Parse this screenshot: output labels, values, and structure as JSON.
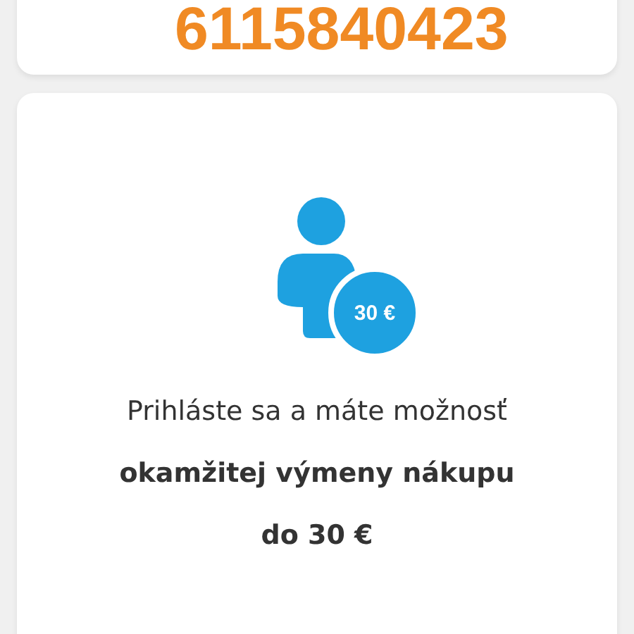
{
  "card_number": "6115840423",
  "offer": {
    "badge": "30 €",
    "lines": [
      {
        "text": "Prihláste sa a máte možnosť",
        "bold": false
      },
      {
        "text": "okamžitej výmeny nákupu",
        "bold": true
      },
      {
        "text": "do 30 €",
        "bold": true
      }
    ]
  }
}
